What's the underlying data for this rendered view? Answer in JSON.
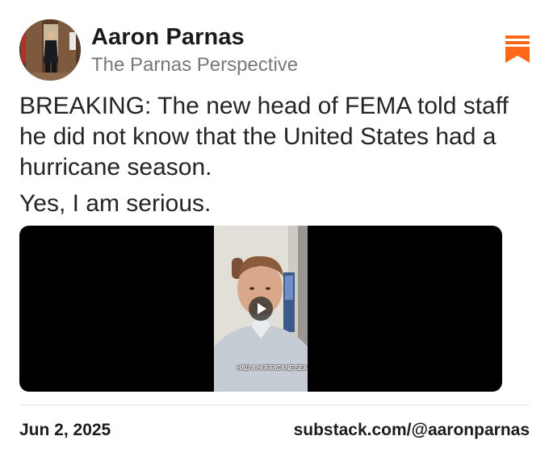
{
  "author": {
    "name": "Aaron Parnas",
    "publication": "The Parnas Perspective"
  },
  "post": {
    "paragraphs": [
      "BREAKING: The new head of FEMA told staff he did not know that the United States had a hurricane season.",
      "Yes, I am serious."
    ]
  },
  "video": {
    "caption": "HAD A HURRICANE SEASON",
    "play_icon": "play-icon"
  },
  "footer": {
    "date": "Jun 2, 2025",
    "profile_url": "substack.com/@aaronparnas"
  },
  "icons": {
    "brand": "substack-logo-icon"
  },
  "colors": {
    "brand_accent": "#ff6719",
    "text_primary": "#1f1f1f",
    "text_secondary": "#787878"
  }
}
